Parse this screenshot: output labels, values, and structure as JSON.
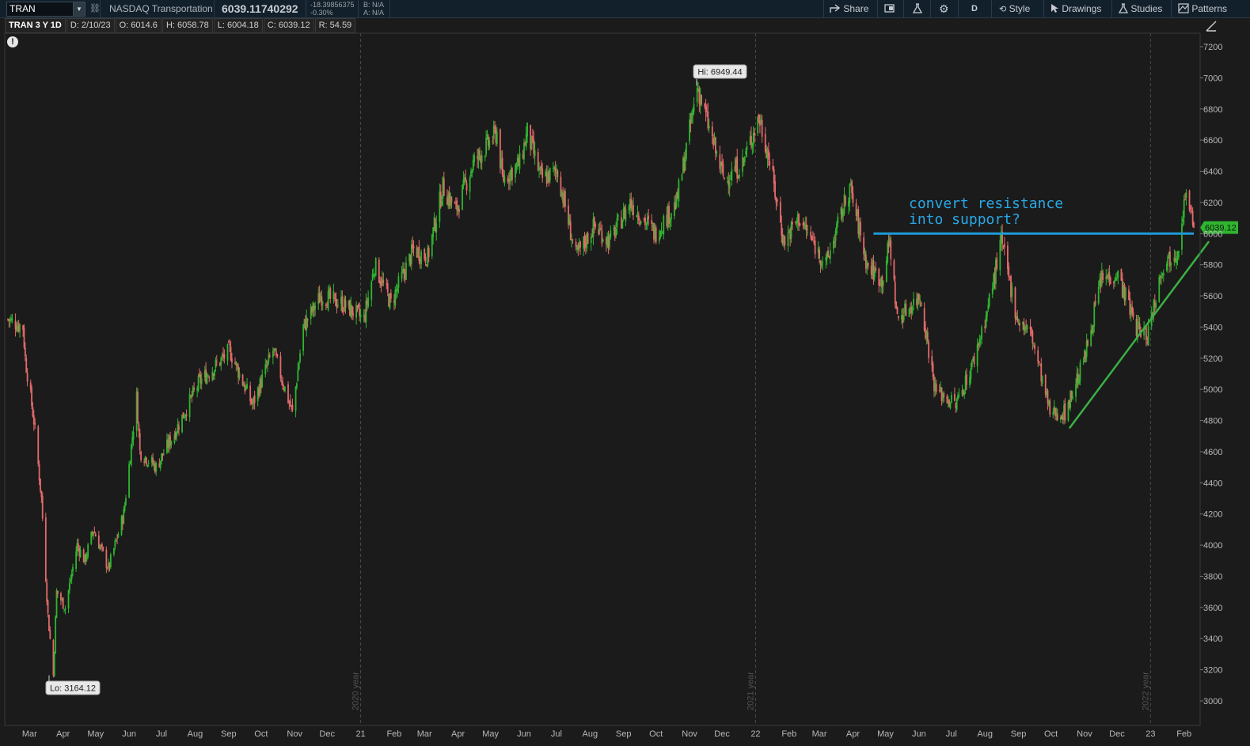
{
  "toolbar": {
    "symbol": "TRAN",
    "description": "NASDAQ Transportation",
    "last_price": "6039.11740292",
    "change_net": "-18.39856375",
    "change_pct": "-0.30%",
    "bid": "B: N/A",
    "ask": "A: N/A",
    "share_label": "Share",
    "aggregation_label": "D",
    "style_label": "Style",
    "drawings_label": "Drawings",
    "studies_label": "Studies",
    "patterns_label": "Patterns",
    "icons": [
      "link-icon",
      "share-icon",
      "flag-icon",
      "flask-icon",
      "gear-icon",
      "style-icon",
      "cursor-icon",
      "studies-icon",
      "patterns-icon",
      "draw-tool-icon",
      "alert-icon"
    ]
  },
  "infobar": {
    "title": "TRAN 3 Y 1D",
    "date": "D: 2/10/23",
    "open": "O: 6014.6",
    "high": "H: 6058.78",
    "low": "L: 6004.18",
    "close": "C: 6039.12",
    "range": "R: 54.59"
  },
  "colors": {
    "background": "#1b1b1b",
    "up_candle": "#2fb52f",
    "down_candle": "#e46a6a",
    "resistance_line": "#1e9bd7",
    "trend_line": "#3cb043",
    "annotation_text": "#29a8e6",
    "price_badge": "#2fb52f"
  },
  "chart_data": {
    "type": "candlestick",
    "title": "",
    "ylim": [
      2900,
      7300
    ],
    "yticks": [
      3000,
      3200,
      3400,
      3600,
      3800,
      4000,
      4200,
      4400,
      4600,
      4800,
      5000,
      5200,
      5400,
      5600,
      5800,
      6000,
      6200,
      6400,
      6600,
      6800,
      7000,
      7200
    ],
    "xticks": [
      "Mar",
      "Apr",
      "May",
      "Jun",
      "Jul",
      "Aug",
      "Sep",
      "Oct",
      "Nov",
      "Dec",
      "21",
      "Feb",
      "Mar",
      "Apr",
      "May",
      "Jun",
      "Jul",
      "Aug",
      "Sep",
      "Oct",
      "Nov",
      "Dec",
      "22",
      "Feb",
      "Mar",
      "Apr",
      "May",
      "Jun",
      "Jul",
      "Aug",
      "Sep",
      "Oct",
      "Nov",
      "Dec",
      "23",
      "Feb"
    ],
    "year_dividers": [
      {
        "label": "2020 year",
        "after_tick": "Dec",
        "before_tick": "21"
      },
      {
        "label": "2021 year",
        "after_tick": "Dec",
        "before_tick": "22"
      },
      {
        "label": "2022 year",
        "after_tick": "Dec",
        "before_tick": "23"
      }
    ],
    "path_points": [
      {
        "date": "2020-02-10",
        "close": 5450
      },
      {
        "date": "2020-02-24",
        "close": 5400
      },
      {
        "date": "2020-02-26",
        "close": 5200
      },
      {
        "date": "2020-03-05",
        "close": 4800
      },
      {
        "date": "2020-03-12",
        "close": 4300
      },
      {
        "date": "2020-03-18",
        "close": 3550
      },
      {
        "date": "2020-03-23",
        "close": 3164.12
      },
      {
        "date": "2020-03-26",
        "close": 3700
      },
      {
        "date": "2020-04-03",
        "close": 3600
      },
      {
        "date": "2020-04-14",
        "close": 4000
      },
      {
        "date": "2020-04-21",
        "close": 3900
      },
      {
        "date": "2020-04-29",
        "close": 4100
      },
      {
        "date": "2020-05-13",
        "close": 3850
      },
      {
        "date": "2020-05-27",
        "close": 4200
      },
      {
        "date": "2020-06-08",
        "close": 4950
      },
      {
        "date": "2020-06-11",
        "close": 4600
      },
      {
        "date": "2020-06-26",
        "close": 4500
      },
      {
        "date": "2020-07-15",
        "close": 4750
      },
      {
        "date": "2020-08-05",
        "close": 5050
      },
      {
        "date": "2020-08-20",
        "close": 5150
      },
      {
        "date": "2020-09-02",
        "close": 5250
      },
      {
        "date": "2020-09-23",
        "close": 4900
      },
      {
        "date": "2020-10-12",
        "close": 5250
      },
      {
        "date": "2020-10-30",
        "close": 4850
      },
      {
        "date": "2020-11-09",
        "close": 5400
      },
      {
        "date": "2020-11-25",
        "close": 5600
      },
      {
        "date": "2020-12-15",
        "close": 5550
      },
      {
        "date": "2021-01-04",
        "close": 5450
      },
      {
        "date": "2021-01-14",
        "close": 5800
      },
      {
        "date": "2021-01-29",
        "close": 5550
      },
      {
        "date": "2021-02-19",
        "close": 5900
      },
      {
        "date": "2021-03-04",
        "close": 5850
      },
      {
        "date": "2021-03-18",
        "close": 6300
      },
      {
        "date": "2021-03-30",
        "close": 6150
      },
      {
        "date": "2021-04-15",
        "close": 6450
      },
      {
        "date": "2021-05-07",
        "close": 6650
      },
      {
        "date": "2021-05-12",
        "close": 6350
      },
      {
        "date": "2021-05-28",
        "close": 6450
      },
      {
        "date": "2021-06-04",
        "close": 6650
      },
      {
        "date": "2021-06-17",
        "close": 6350
      },
      {
        "date": "2021-07-02",
        "close": 6400
      },
      {
        "date": "2021-07-19",
        "close": 5850
      },
      {
        "date": "2021-08-05",
        "close": 6050
      },
      {
        "date": "2021-08-19",
        "close": 5950
      },
      {
        "date": "2021-09-07",
        "close": 6200
      },
      {
        "date": "2021-09-30",
        "close": 6000
      },
      {
        "date": "2021-10-20",
        "close": 6200
      },
      {
        "date": "2021-11-02",
        "close": 6700
      },
      {
        "date": "2021-11-08",
        "close": 6949.44
      },
      {
        "date": "2021-11-26",
        "close": 6500
      },
      {
        "date": "2021-12-03",
        "close": 6350
      },
      {
        "date": "2021-12-20",
        "close": 6450
      },
      {
        "date": "2022-01-04",
        "close": 6750
      },
      {
        "date": "2022-01-13",
        "close": 6500
      },
      {
        "date": "2022-01-27",
        "close": 5950
      },
      {
        "date": "2022-02-10",
        "close": 6100
      },
      {
        "date": "2022-03-07",
        "close": 5800
      },
      {
        "date": "2022-03-29",
        "close": 6300
      },
      {
        "date": "2022-04-14",
        "close": 5800
      },
      {
        "date": "2022-04-28",
        "close": 5700
      },
      {
        "date": "2022-05-05",
        "close": 5950
      },
      {
        "date": "2022-05-12",
        "close": 5450
      },
      {
        "date": "2022-06-02",
        "close": 5600
      },
      {
        "date": "2022-06-16",
        "close": 5000
      },
      {
        "date": "2022-07-05",
        "close": 4900
      },
      {
        "date": "2022-07-20",
        "close": 5150
      },
      {
        "date": "2022-08-03",
        "close": 5500
      },
      {
        "date": "2022-08-16",
        "close": 5950
      },
      {
        "date": "2022-08-31",
        "close": 5450
      },
      {
        "date": "2022-09-13",
        "close": 5350
      },
      {
        "date": "2022-09-30",
        "close": 4850
      },
      {
        "date": "2022-10-14",
        "close": 4850
      },
      {
        "date": "2022-11-01",
        "close": 5200
      },
      {
        "date": "2022-11-16",
        "close": 5700
      },
      {
        "date": "2022-12-01",
        "close": 5750
      },
      {
        "date": "2022-12-19",
        "close": 5400
      },
      {
        "date": "2022-12-29",
        "close": 5350
      },
      {
        "date": "2023-01-12",
        "close": 5800
      },
      {
        "date": "2023-01-26",
        "close": 5900
      },
      {
        "date": "2023-02-02",
        "close": 6250
      },
      {
        "date": "2023-02-10",
        "close": 6039.12
      }
    ],
    "annotations": {
      "high_label": "Hi: 6949.44",
      "low_label": "Lo: 3164.12",
      "current_price_label": "6039.12",
      "note_line1": "convert resistance",
      "note_line2": "into support?"
    },
    "resistance_line": {
      "value": 6000,
      "from": "2022-04-20",
      "to": "2023-02-10"
    },
    "trend_line": {
      "from": {
        "date": "2022-10-18",
        "value": 4750
      },
      "to": {
        "date": "2023-02-24",
        "value": 5950
      }
    }
  }
}
